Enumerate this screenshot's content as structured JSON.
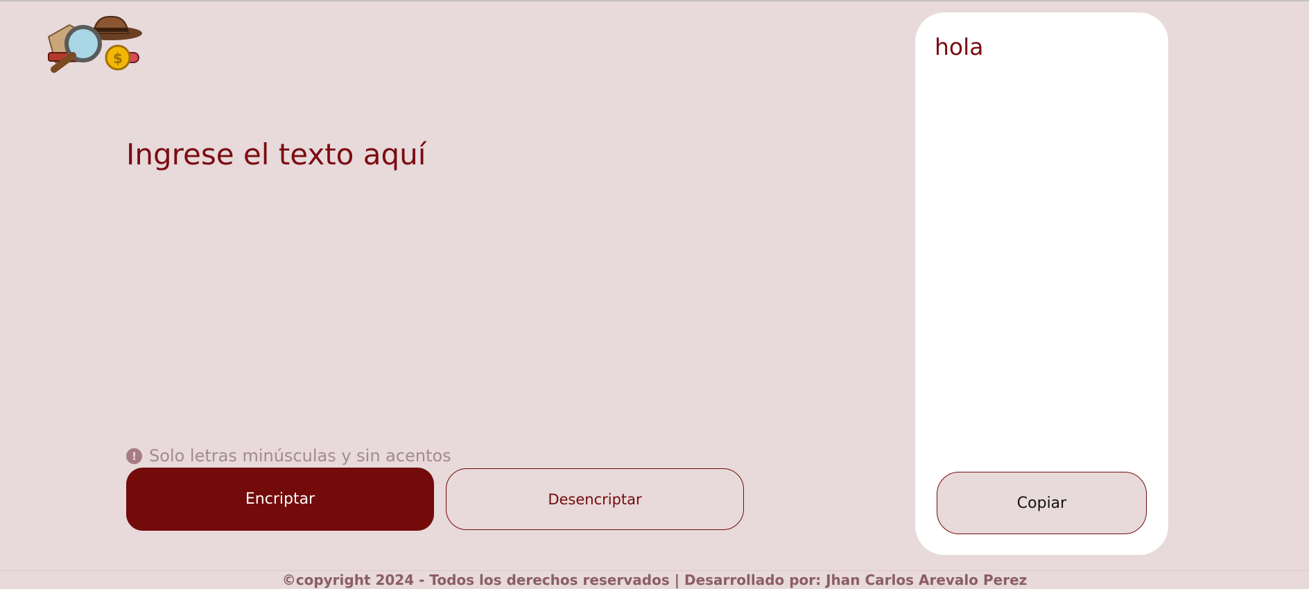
{
  "logo": {
    "icon": "detective-magnifier-logo-icon"
  },
  "input": {
    "placeholder": "Ingrese el texto aquí"
  },
  "hint": {
    "icon": "exclamation-circle-icon",
    "text": "Solo letras minúsculas y sin acentos"
  },
  "buttons": {
    "encrypt": "Encriptar",
    "decrypt": "Desencriptar"
  },
  "output": {
    "text": "hola",
    "copy": "Copiar"
  },
  "footer": {
    "text": "©copyright 2024 - Todos los derechos reservados | Desarrollado por: Jhan Carlos Arevalo Perez"
  },
  "colors": {
    "background": "#e8d9da",
    "accent": "#720b0a",
    "panel": "#ffffff",
    "hint": "#a38b8d"
  }
}
